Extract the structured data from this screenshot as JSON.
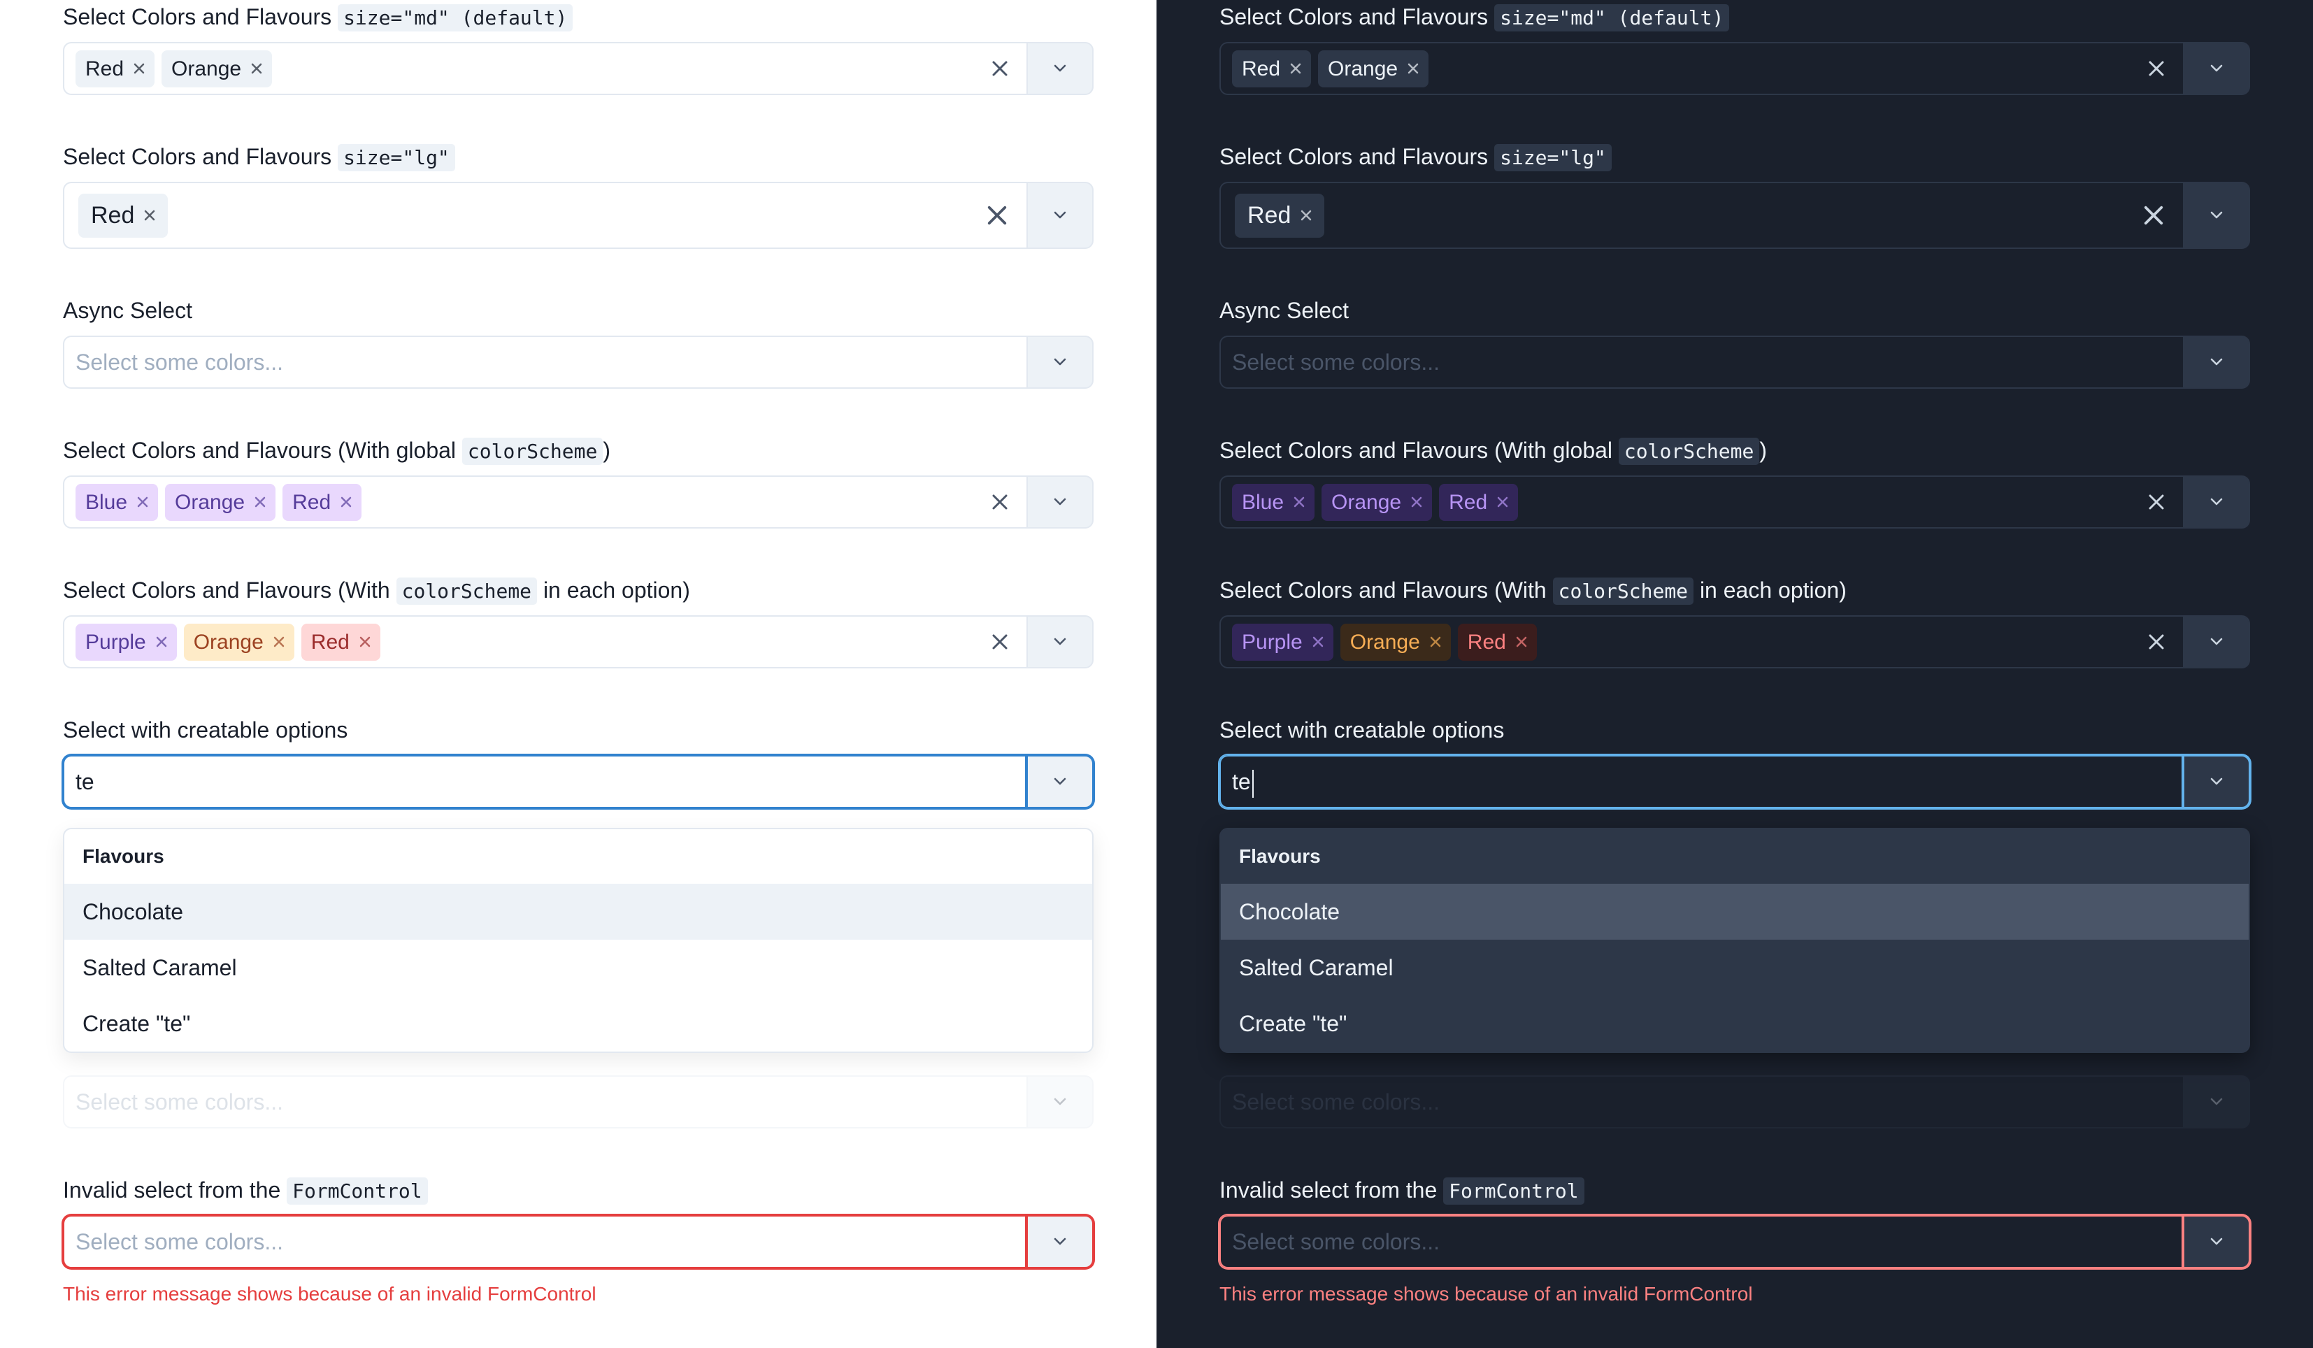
{
  "labels": {
    "colorsFlavours": "Select Colors and Flavours",
    "sizeMdBadge": "size=\"md\" (default)",
    "sizeLgBadge": "size=\"lg\"",
    "asyncSelect": "Async Select",
    "globalScheme_pre": "Select Colors and Flavours (With global ",
    "globalScheme_code": "colorScheme",
    "globalScheme_post": ")",
    "perOption_pre": "Select Colors and Flavours (With ",
    "perOption_code": "colorScheme",
    "perOption_post": " in each option)",
    "creatable": "Select with creatable options",
    "invalid_pre": "Invalid select from the ",
    "invalid_code": "FormControl"
  },
  "placeholders": {
    "someColors": "Select some colors..."
  },
  "selects": {
    "md": {
      "tags": [
        "Red",
        "Orange"
      ]
    },
    "lg": {
      "tags": [
        "Red"
      ]
    },
    "globalScheme": {
      "tags": [
        "Blue",
        "Orange",
        "Red"
      ]
    },
    "perOption": {
      "tags": [
        {
          "label": "Purple",
          "scheme": "purple"
        },
        {
          "label": "Orange",
          "scheme": "orange"
        },
        {
          "label": "Red",
          "scheme": "red"
        }
      ]
    },
    "creatable": {
      "input": "te",
      "groupLabel": "Flavours",
      "options": [
        "Chocolate",
        "Salted Caramel",
        "Create \"te\""
      ]
    }
  },
  "error": "This error message shows because of an invalid FormControl",
  "colors": {
    "accentLight": "#3182ce",
    "accentDark": "#63b3ed",
    "errorLight": "#e53e3e",
    "errorDark": "#fc8181"
  }
}
